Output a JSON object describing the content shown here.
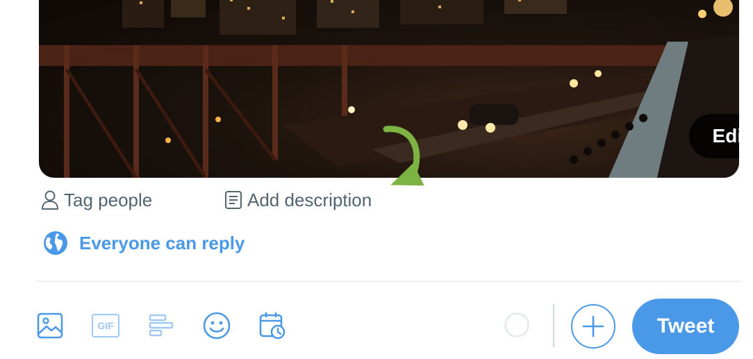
{
  "media": {
    "image_alt": "Night view of a bridge with traffic and city lights",
    "edit_label": "Edit"
  },
  "media_actions": {
    "tag_people_label": "Tag people",
    "add_description_label": "Add description"
  },
  "reply_setting": {
    "label": "Everyone can reply"
  },
  "toolbar": {
    "gif_label": "GIF",
    "tweet_label": "Tweet"
  },
  "icons": {
    "tag": "person-outline-icon",
    "description": "description-icon",
    "globe": "globe-icon",
    "media": "image-icon",
    "gif": "gif-icon",
    "poll": "poll-icon",
    "emoji": "emoji-icon",
    "schedule": "schedule-icon",
    "add": "plus-icon"
  },
  "colors": {
    "accent": "#4a99e9",
    "accent_light": "#9fc9f3",
    "muted_text": "#536471",
    "annotation_arrow": "#7cb342"
  }
}
